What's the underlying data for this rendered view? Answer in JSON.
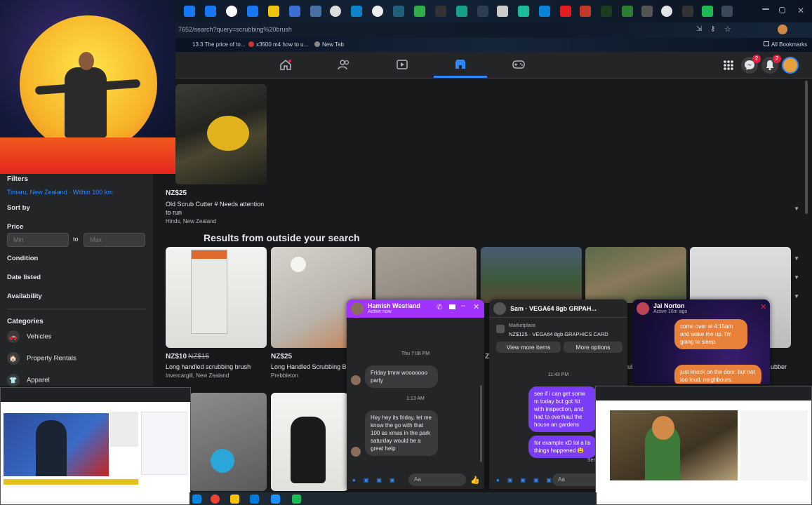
{
  "browser": {
    "url": "7652/search?query=scrubbing%20brush",
    "bookmarks": [
      "13.3 The price of to...",
      "x3500 m4 how to u...",
      "New Tab"
    ],
    "all_bookmarks": "All Bookmarks"
  },
  "header": {
    "nav": [
      "home-icon",
      "friends-icon",
      "watch-icon",
      "marketplace-icon",
      "gaming-icon"
    ],
    "badges": {
      "messenger": "2",
      "notifications": "2"
    }
  },
  "sidebar": {
    "filters_title": "Filters",
    "location": "Timaru, New Zealand · Within 100 km",
    "sort_by": "Sort by",
    "price_label": "Price",
    "min_placeholder": "Min",
    "to_label": "to",
    "max_placeholder": "Max",
    "condition": "Condition",
    "date_listed": "Date listed",
    "availability": "Availability",
    "categories_title": "Categories",
    "categories": [
      "Vehicles",
      "Property Rentals",
      "Apparel"
    ]
  },
  "main": {
    "top_listing": {
      "price": "NZ$25",
      "title": "Old Scrub Cutter # Needs attention to run",
      "location": "Hinds, New Zealand"
    },
    "outside_title": "Results from outside your search",
    "listings": [
      {
        "price": "NZ$10",
        "old_price": "NZ$15",
        "title": "Long handled scrubbing brush",
        "location": "Invercargill, New Zealand"
      },
      {
        "price": "NZ$25",
        "title": "Long Handled Scrubbing Br",
        "location": "Prebbleton"
      },
      {
        "price": "Z",
        "title": "",
        "location": ""
      },
      {
        "price": "",
        "title": "ub",
        "location": ""
      },
      {
        "price": "",
        "title": "ubber",
        "location": ""
      }
    ]
  },
  "chats": {
    "hamish": {
      "name": "Hamish Westland",
      "status": "Active now",
      "stamp1": "Thu 7:08 PM",
      "msg1": "Friday tmrw wooooooo party",
      "stamp2": "1:13 AM",
      "msg2": "Hey hey its friday, let me know the go with that 100 as xmas in the park saturday would be a great help",
      "input": "Aa"
    },
    "sam": {
      "name": "Sam · VEGA64 8gb GRPAH...",
      "marketplace_label": "Marketplace",
      "listing": "NZ$125 · VEGA64 8gb GRAPHICS CARD",
      "view_more": "View more items",
      "more_options": "More options",
      "stamp": "11:43 PM",
      "msg1": "see if i can get some m today but got hit with inspection, and had to overhaul the house an gardens",
      "msg2": "for example xD lol a lis things happened 😩",
      "seen": "Sen",
      "input": "Aa"
    },
    "jai": {
      "name": "Jai Norton",
      "status": "Active 16m ago",
      "msg1": "come over at 4:15am and wake me up. I'm going to sleep.",
      "msg2": "just knock on the door. but not too loud. neighbours."
    }
  },
  "colors": {
    "fb_bg": "#18191a",
    "fb_card": "#242526",
    "accent": "#2d88ff",
    "hamish_header": "#a033ff",
    "orange_bubble": "#e8813a"
  }
}
